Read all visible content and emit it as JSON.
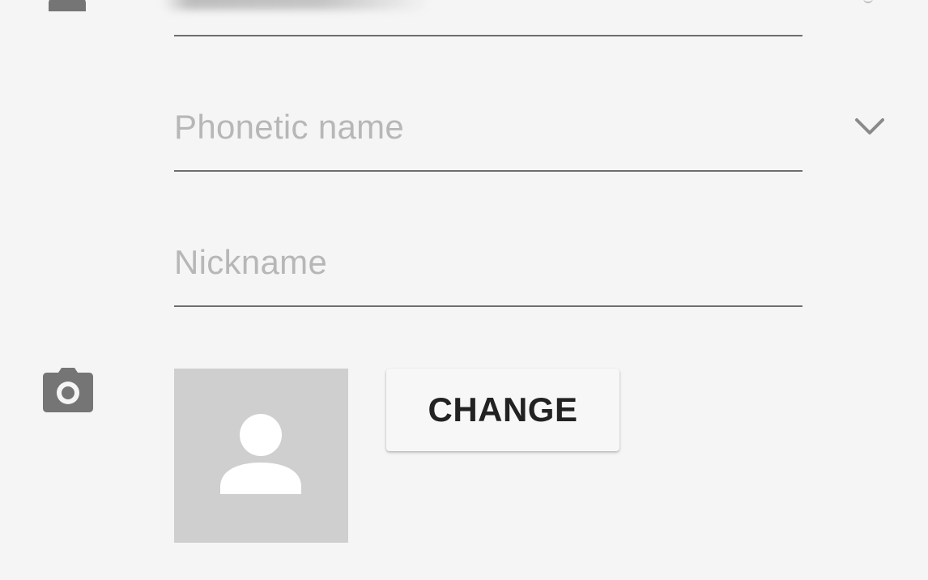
{
  "name_field": {
    "icon": "person-icon",
    "value_blurred": true
  },
  "phonetic_name": {
    "placeholder": "Phonetic name",
    "expand_icon": "chevron-down-icon"
  },
  "nickname": {
    "placeholder": "Nickname"
  },
  "photo": {
    "icon": "camera-icon",
    "placeholder_icon": "default-avatar-icon",
    "change_label": "CHANGE"
  },
  "colors": {
    "background": "#f5f5f5",
    "icon_gray": "#757575",
    "placeholder_text": "#b7b7b7",
    "underline": "#6e6e6e",
    "photo_bg": "#cfcfcf",
    "avatar_fg": "#ffffff",
    "button_text": "#222222"
  }
}
